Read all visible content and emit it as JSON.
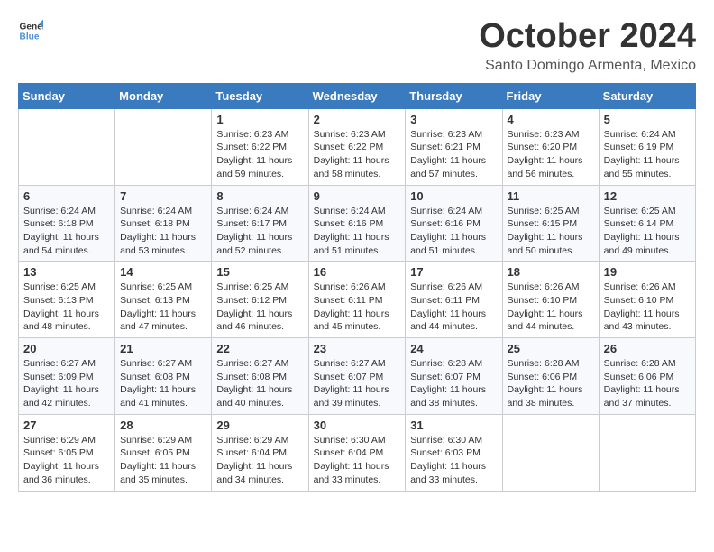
{
  "header": {
    "logo_general": "General",
    "logo_blue": "Blue",
    "month": "October 2024",
    "location": "Santo Domingo Armenta, Mexico"
  },
  "days_of_week": [
    "Sunday",
    "Monday",
    "Tuesday",
    "Wednesday",
    "Thursday",
    "Friday",
    "Saturday"
  ],
  "weeks": [
    [
      {
        "day": "",
        "sunrise": "",
        "sunset": "",
        "daylight": ""
      },
      {
        "day": "",
        "sunrise": "",
        "sunset": "",
        "daylight": ""
      },
      {
        "day": "1",
        "sunrise": "Sunrise: 6:23 AM",
        "sunset": "Sunset: 6:22 PM",
        "daylight": "Daylight: 11 hours and 59 minutes."
      },
      {
        "day": "2",
        "sunrise": "Sunrise: 6:23 AM",
        "sunset": "Sunset: 6:22 PM",
        "daylight": "Daylight: 11 hours and 58 minutes."
      },
      {
        "day": "3",
        "sunrise": "Sunrise: 6:23 AM",
        "sunset": "Sunset: 6:21 PM",
        "daylight": "Daylight: 11 hours and 57 minutes."
      },
      {
        "day": "4",
        "sunrise": "Sunrise: 6:23 AM",
        "sunset": "Sunset: 6:20 PM",
        "daylight": "Daylight: 11 hours and 56 minutes."
      },
      {
        "day": "5",
        "sunrise": "Sunrise: 6:24 AM",
        "sunset": "Sunset: 6:19 PM",
        "daylight": "Daylight: 11 hours and 55 minutes."
      }
    ],
    [
      {
        "day": "6",
        "sunrise": "Sunrise: 6:24 AM",
        "sunset": "Sunset: 6:18 PM",
        "daylight": "Daylight: 11 hours and 54 minutes."
      },
      {
        "day": "7",
        "sunrise": "Sunrise: 6:24 AM",
        "sunset": "Sunset: 6:18 PM",
        "daylight": "Daylight: 11 hours and 53 minutes."
      },
      {
        "day": "8",
        "sunrise": "Sunrise: 6:24 AM",
        "sunset": "Sunset: 6:17 PM",
        "daylight": "Daylight: 11 hours and 52 minutes."
      },
      {
        "day": "9",
        "sunrise": "Sunrise: 6:24 AM",
        "sunset": "Sunset: 6:16 PM",
        "daylight": "Daylight: 11 hours and 51 minutes."
      },
      {
        "day": "10",
        "sunrise": "Sunrise: 6:24 AM",
        "sunset": "Sunset: 6:16 PM",
        "daylight": "Daylight: 11 hours and 51 minutes."
      },
      {
        "day": "11",
        "sunrise": "Sunrise: 6:25 AM",
        "sunset": "Sunset: 6:15 PM",
        "daylight": "Daylight: 11 hours and 50 minutes."
      },
      {
        "day": "12",
        "sunrise": "Sunrise: 6:25 AM",
        "sunset": "Sunset: 6:14 PM",
        "daylight": "Daylight: 11 hours and 49 minutes."
      }
    ],
    [
      {
        "day": "13",
        "sunrise": "Sunrise: 6:25 AM",
        "sunset": "Sunset: 6:13 PM",
        "daylight": "Daylight: 11 hours and 48 minutes."
      },
      {
        "day": "14",
        "sunrise": "Sunrise: 6:25 AM",
        "sunset": "Sunset: 6:13 PM",
        "daylight": "Daylight: 11 hours and 47 minutes."
      },
      {
        "day": "15",
        "sunrise": "Sunrise: 6:25 AM",
        "sunset": "Sunset: 6:12 PM",
        "daylight": "Daylight: 11 hours and 46 minutes."
      },
      {
        "day": "16",
        "sunrise": "Sunrise: 6:26 AM",
        "sunset": "Sunset: 6:11 PM",
        "daylight": "Daylight: 11 hours and 45 minutes."
      },
      {
        "day": "17",
        "sunrise": "Sunrise: 6:26 AM",
        "sunset": "Sunset: 6:11 PM",
        "daylight": "Daylight: 11 hours and 44 minutes."
      },
      {
        "day": "18",
        "sunrise": "Sunrise: 6:26 AM",
        "sunset": "Sunset: 6:10 PM",
        "daylight": "Daylight: 11 hours and 44 minutes."
      },
      {
        "day": "19",
        "sunrise": "Sunrise: 6:26 AM",
        "sunset": "Sunset: 6:10 PM",
        "daylight": "Daylight: 11 hours and 43 minutes."
      }
    ],
    [
      {
        "day": "20",
        "sunrise": "Sunrise: 6:27 AM",
        "sunset": "Sunset: 6:09 PM",
        "daylight": "Daylight: 11 hours and 42 minutes."
      },
      {
        "day": "21",
        "sunrise": "Sunrise: 6:27 AM",
        "sunset": "Sunset: 6:08 PM",
        "daylight": "Daylight: 11 hours and 41 minutes."
      },
      {
        "day": "22",
        "sunrise": "Sunrise: 6:27 AM",
        "sunset": "Sunset: 6:08 PM",
        "daylight": "Daylight: 11 hours and 40 minutes."
      },
      {
        "day": "23",
        "sunrise": "Sunrise: 6:27 AM",
        "sunset": "Sunset: 6:07 PM",
        "daylight": "Daylight: 11 hours and 39 minutes."
      },
      {
        "day": "24",
        "sunrise": "Sunrise: 6:28 AM",
        "sunset": "Sunset: 6:07 PM",
        "daylight": "Daylight: 11 hours and 38 minutes."
      },
      {
        "day": "25",
        "sunrise": "Sunrise: 6:28 AM",
        "sunset": "Sunset: 6:06 PM",
        "daylight": "Daylight: 11 hours and 38 minutes."
      },
      {
        "day": "26",
        "sunrise": "Sunrise: 6:28 AM",
        "sunset": "Sunset: 6:06 PM",
        "daylight": "Daylight: 11 hours and 37 minutes."
      }
    ],
    [
      {
        "day": "27",
        "sunrise": "Sunrise: 6:29 AM",
        "sunset": "Sunset: 6:05 PM",
        "daylight": "Daylight: 11 hours and 36 minutes."
      },
      {
        "day": "28",
        "sunrise": "Sunrise: 6:29 AM",
        "sunset": "Sunset: 6:05 PM",
        "daylight": "Daylight: 11 hours and 35 minutes."
      },
      {
        "day": "29",
        "sunrise": "Sunrise: 6:29 AM",
        "sunset": "Sunset: 6:04 PM",
        "daylight": "Daylight: 11 hours and 34 minutes."
      },
      {
        "day": "30",
        "sunrise": "Sunrise: 6:30 AM",
        "sunset": "Sunset: 6:04 PM",
        "daylight": "Daylight: 11 hours and 33 minutes."
      },
      {
        "day": "31",
        "sunrise": "Sunrise: 6:30 AM",
        "sunset": "Sunset: 6:03 PM",
        "daylight": "Daylight: 11 hours and 33 minutes."
      },
      {
        "day": "",
        "sunrise": "",
        "sunset": "",
        "daylight": ""
      },
      {
        "day": "",
        "sunrise": "",
        "sunset": "",
        "daylight": ""
      }
    ]
  ]
}
